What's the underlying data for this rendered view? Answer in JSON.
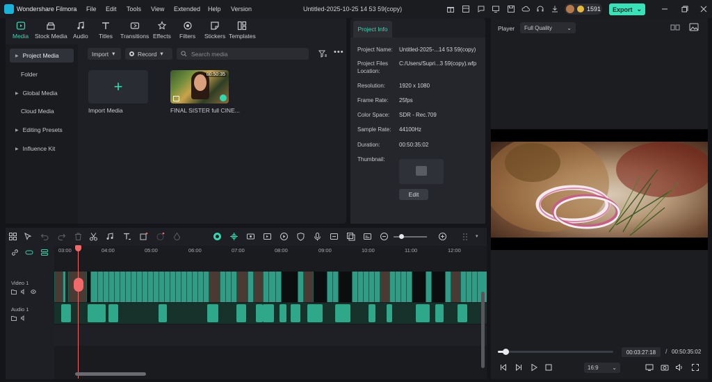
{
  "app": {
    "title": "Wondershare Filmora",
    "window_title": "Untitled-2025-10-25 14 53 59(copy)",
    "points": "1591",
    "export_label": "Export"
  },
  "menu": [
    "File",
    "Edit",
    "Tools",
    "View",
    "Extended",
    "Help",
    "Version"
  ],
  "media_tabs": [
    {
      "label": "Media",
      "icon": "media-icon",
      "active": true
    },
    {
      "label": "Stock Media",
      "icon": "stock-media-icon"
    },
    {
      "label": "Audio",
      "icon": "music-note-icon"
    },
    {
      "label": "Titles",
      "icon": "titles-icon"
    },
    {
      "label": "Transitions",
      "icon": "transitions-icon"
    },
    {
      "label": "Effects",
      "icon": "effects-icon"
    },
    {
      "label": "Filters",
      "icon": "filters-icon"
    },
    {
      "label": "Stickers",
      "icon": "stickers-icon"
    },
    {
      "label": "Templates",
      "icon": "templates-icon"
    }
  ],
  "sidebar": [
    {
      "label": "Project Media",
      "caret": true,
      "active": true
    },
    {
      "label": "Folder",
      "caret": false
    },
    {
      "label": "Global Media",
      "caret": true
    },
    {
      "label": "Cloud Media",
      "caret": false
    },
    {
      "label": "Editing Presets",
      "caret": true
    },
    {
      "label": "Influence Kit",
      "caret": true
    }
  ],
  "media_toolbar": {
    "import_label": "Import",
    "record_label": "Record",
    "search_placeholder": "Search media"
  },
  "media_items": {
    "import_label": "Import Media",
    "clip_label": "FINAL SISTER full CINE...",
    "clip_duration": "00:50:35"
  },
  "project_info": {
    "tab": "Project Info",
    "fields": [
      {
        "key": "Project Name:",
        "value": "Untitled-2025-...14 53 59(copy)"
      },
      {
        "key": "Project Files Location:",
        "value": "C:/Users/Supri...3 59(copy).wfp"
      },
      {
        "key": "Resolution:",
        "value": "1920 x 1080"
      },
      {
        "key": "Frame Rate:",
        "value": "25fps"
      },
      {
        "key": "Color Space:",
        "value": "SDR - Rec.709"
      },
      {
        "key": "Sample Rate:",
        "value": "44100Hz"
      },
      {
        "key": "Duration:",
        "value": "00:50:35:02"
      },
      {
        "key": "Thumbnail:",
        "value": ""
      }
    ],
    "edit_label": "Edit"
  },
  "player": {
    "label": "Player",
    "quality": "Full Quality",
    "current_time": "00:03:27:18",
    "separator": "/",
    "total_time": "00:50:35:02",
    "ratio": "16:9",
    "progress_fraction": 0.068
  },
  "timeline": {
    "ruler": [
      "03:00",
      "04:00",
      "05:00",
      "06:00",
      "07:00",
      "08:00",
      "09:00",
      "10:00",
      "11:00",
      "12:00"
    ],
    "tracks": {
      "video": "Video 1",
      "audio": "Audio 1"
    }
  },
  "colors": {
    "accent": "#34d8b0",
    "playhead": "#f06a6a",
    "export": "#38e2b8"
  }
}
